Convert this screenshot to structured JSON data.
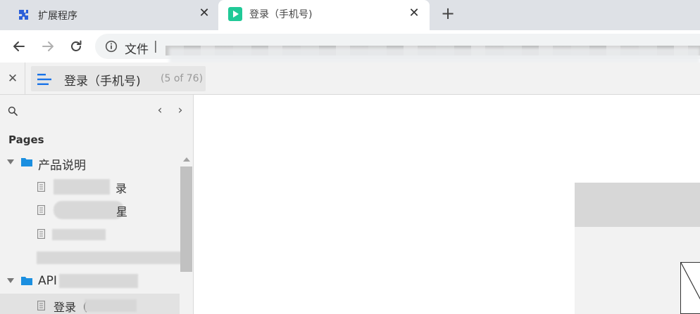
{
  "browser": {
    "tabs": [
      {
        "title": "扩展程序",
        "icon": "puzzle-icon",
        "active": false
      },
      {
        "title": "登录（手机号)",
        "icon": "axure-play-icon",
        "active": true
      }
    ],
    "new_tab_icon": "plus-icon",
    "toolbar": {
      "back_icon": "arrow-left-icon",
      "forward_icon": "arrow-right-icon",
      "reload_icon": "reload-icon",
      "omnibox": {
        "info_icon": "info-icon",
        "scheme_label": "文件",
        "separator": "|"
      }
    }
  },
  "axure": {
    "close_icon": "close-icon",
    "current_page": {
      "title": "登录（手机号)",
      "count": "(5 of 76)"
    },
    "sidebar": {
      "heading": "Pages",
      "tree": [
        {
          "type": "folder",
          "label": "产品说明",
          "expanded": true
        },
        {
          "type": "page",
          "label": "录"
        },
        {
          "type": "page",
          "label": "星"
        },
        {
          "type": "page",
          "label": ""
        },
        {
          "type": "page",
          "label": ""
        },
        {
          "type": "folder",
          "label": "API",
          "expanded": true
        },
        {
          "type": "page",
          "label": "登录（",
          "selected": true
        }
      ]
    }
  },
  "colors": {
    "tabstrip": "#dee1e6",
    "active_tab": "#ffffff",
    "axure_accent": "#1a73e8",
    "folder": "#1b8fe0",
    "play_badge": "#20c997"
  }
}
